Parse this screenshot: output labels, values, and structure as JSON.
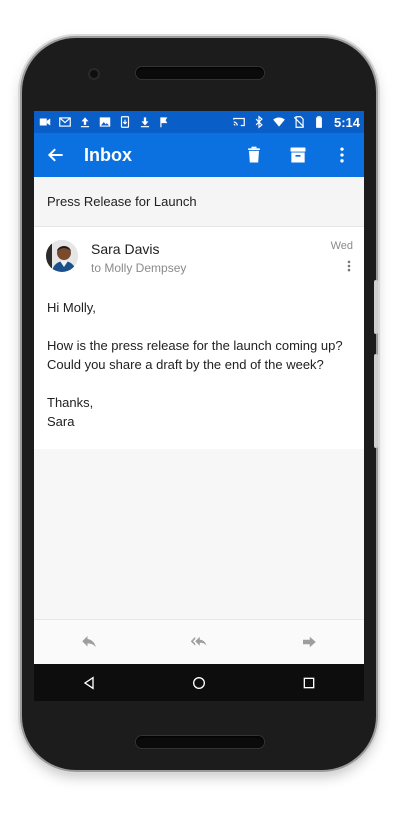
{
  "status": {
    "time": "5:14",
    "left_icons": [
      "video-icon",
      "gmail-icon",
      "upload-icon",
      "image-icon",
      "download-file-icon",
      "download-icon",
      "flag-icon"
    ],
    "right_icons": [
      "cast-icon",
      "bluetooth-icon",
      "wifi-icon",
      "no-sim-icon",
      "battery-icon"
    ]
  },
  "appbar": {
    "title": "Inbox",
    "accent": "#0b70e0",
    "statusbar_color": "#0a5ec7"
  },
  "subject": "Press Release for Launch",
  "message": {
    "sender": "Sara Davis",
    "recipient": "to Molly Dempsey",
    "date": "Wed",
    "greeting": "Hi Molly,",
    "line1": "How is the press release for the launch coming up?",
    "line2": "Could you share a draft by the end of the week?",
    "closing": "Thanks,",
    "signature": "Sara"
  },
  "actions": {
    "reply": "reply-icon",
    "reply_all": "reply-all-icon",
    "forward": "forward-icon"
  },
  "nav": {
    "back": "back-triangle-icon",
    "home": "home-circle-icon",
    "recents": "recents-square-icon"
  }
}
